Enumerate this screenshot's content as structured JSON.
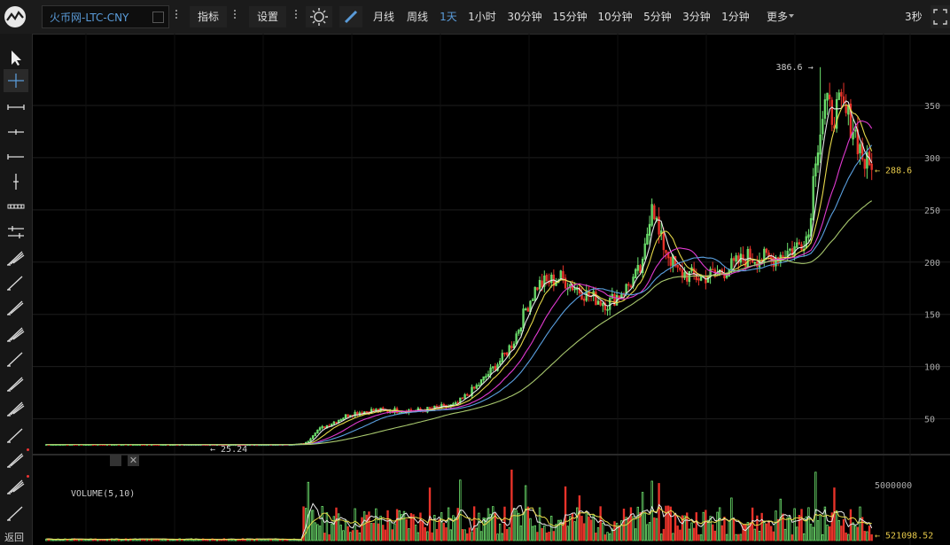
{
  "symbol": "火币网-LTC-CNY",
  "toolbar": {
    "indicators_label": "指标",
    "settings_label": "设置",
    "resolutions": [
      "月线",
      "周线",
      "1天",
      "1小时",
      "30分钟",
      "15分钟",
      "10分钟",
      "5分钟",
      "3分钟",
      "1分钟"
    ],
    "active_resolution": "1天",
    "more_label": "更多",
    "refresh_label": "3秒"
  },
  "left_tools": {
    "icons": [
      "cursor-arrow-icon",
      "crosshair-icon",
      "horizontal-ray-icon",
      "horizontal-line-icon",
      "horizontal-segment-icon",
      "vertical-line-icon",
      "dotted-line-icon",
      "parallel-lines-icon",
      "trend-line-icon",
      "trend-channel-icon",
      "trend-channel-2-icon",
      "arrow-line-icon",
      "pitchfork-icon",
      "pitchfork-2-icon",
      "pitchfork-3-icon",
      "fan-icon",
      "spiral-icon",
      "pattern-icon",
      "trash-icon"
    ],
    "back_label": "返回"
  },
  "colors": {
    "up": "#6ee36e",
    "down": "#e8332a",
    "ma5": "#e8e8e8",
    "ma10": "#e6d94a",
    "ma20": "#e03ad0",
    "ma30": "#5aa0e0",
    "ma60": "#a8c86e",
    "last_price": "#e6c94a",
    "axis_text": "#aaaaaa",
    "grid": "#1e1e1e"
  },
  "chart_data": {
    "type": "candlestick",
    "title": "火币网-LTC-CNY",
    "price_axis": {
      "ticks": [
        50,
        100,
        150,
        200,
        250,
        300,
        350
      ],
      "range": [
        20,
        400
      ]
    },
    "volume_axis": {
      "ticks": [
        5000000
      ],
      "range": [
        0,
        6800000
      ]
    },
    "high_marker": {
      "label": "386.6",
      "value": 386.6
    },
    "low_marker": {
      "label": "25.24",
      "value": 25.24
    },
    "last_price": {
      "label": "288.6",
      "value": 288.6
    },
    "volume_legend": "VOLUME(5,10)",
    "last_volume": {
      "label": "521098.52",
      "value": 521098.52
    },
    "milestones": [
      [
        0,
        25.5
      ],
      [
        40,
        25.5
      ],
      [
        90,
        25.3
      ],
      [
        105,
        25.5
      ],
      [
        111,
        26.5
      ],
      [
        115,
        38
      ],
      [
        130,
        55
      ],
      [
        140,
        58
      ],
      [
        160,
        58
      ],
      [
        175,
        63
      ],
      [
        185,
        83
      ],
      [
        195,
        108
      ],
      [
        200,
        125
      ],
      [
        205,
        155
      ],
      [
        210,
        178
      ],
      [
        220,
        185
      ],
      [
        230,
        170
      ],
      [
        240,
        160
      ],
      [
        248,
        175
      ],
      [
        255,
        195
      ],
      [
        259,
        262
      ],
      [
        262,
        225
      ],
      [
        270,
        190
      ],
      [
        280,
        185
      ],
      [
        290,
        192
      ],
      [
        300,
        205
      ],
      [
        310,
        203
      ],
      [
        320,
        213
      ],
      [
        326,
        227
      ],
      [
        329,
        305
      ],
      [
        333,
        350
      ],
      [
        336,
        342
      ],
      [
        340,
        348
      ],
      [
        345,
        330
      ],
      [
        350,
        295
      ],
      [
        353,
        288.6
      ]
    ],
    "volume_spikes": [
      [
        112,
        5.2
      ],
      [
        164,
        4.7
      ],
      [
        177,
        5.4
      ],
      [
        199,
        6.3
      ],
      [
        205,
        4.9
      ],
      [
        222,
        4.8
      ],
      [
        228,
        4.0
      ],
      [
        255,
        4.3
      ],
      [
        259,
        5.3
      ],
      [
        262,
        5.1
      ],
      [
        293,
        3.8
      ],
      [
        314,
        3.7
      ],
      [
        329,
        6.1
      ],
      [
        337,
        4.7
      ]
    ]
  }
}
